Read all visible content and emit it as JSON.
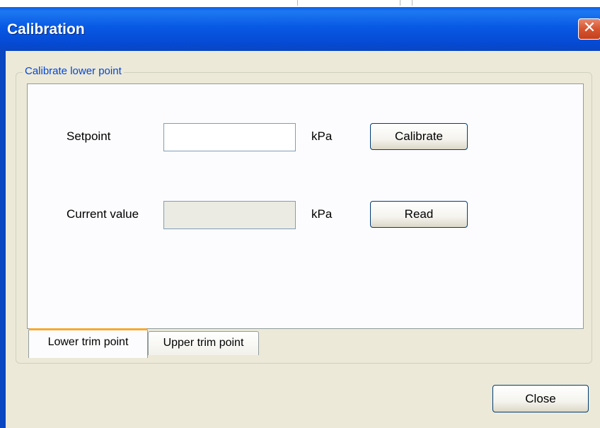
{
  "window": {
    "title": "Calibration",
    "close_glyph": "✕"
  },
  "groupbox": {
    "legend": "Calibrate lower point"
  },
  "form": {
    "setpoint_label": "Setpoint",
    "setpoint_value": "",
    "setpoint_unit": "kPa",
    "calibrate_label": "Calibrate",
    "current_label": "Current value",
    "current_value": "",
    "current_unit": "kPa",
    "read_label": "Read"
  },
  "tabs": [
    {
      "label": "Lower trim point",
      "active": true
    },
    {
      "label": "Upper trim point",
      "active": false
    }
  ],
  "footer": {
    "close_label": "Close"
  },
  "colors": {
    "titlebar": "#0859e4",
    "legend_text": "#0046d5",
    "active_tab_accent": "#f8a830",
    "close_x": "#d6542f"
  },
  "icons": {
    "window_close": "close-icon"
  }
}
